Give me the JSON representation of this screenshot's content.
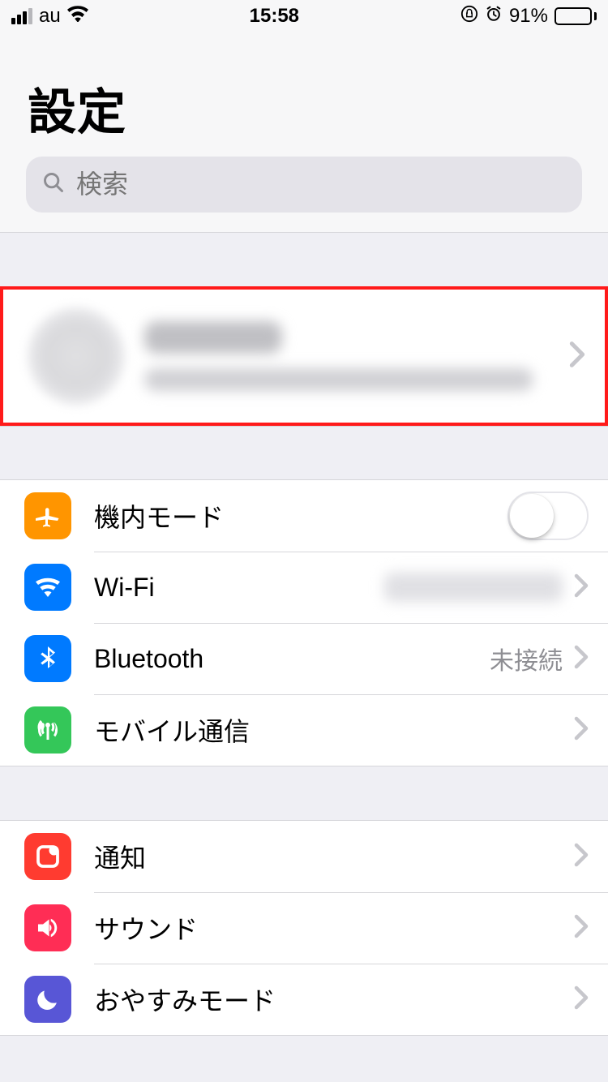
{
  "status": {
    "carrier": "au",
    "time": "15:58",
    "battery_pct": "91%"
  },
  "header": {
    "title": "設定"
  },
  "search": {
    "placeholder": "検索"
  },
  "profile": {
    "name": "",
    "subtitle": ""
  },
  "rows": {
    "airplane": {
      "label": "機内モード",
      "icon": "airplane-icon",
      "toggle": false
    },
    "wifi": {
      "label": "Wi-Fi",
      "icon": "wifi-icon",
      "value": ""
    },
    "bluetooth": {
      "label": "Bluetooth",
      "icon": "bluetooth-icon",
      "value": "未接続"
    },
    "cellular": {
      "label": "モバイル通信",
      "icon": "antenna-icon"
    },
    "notif": {
      "label": "通知",
      "icon": "notification-icon"
    },
    "sound": {
      "label": "サウンド",
      "icon": "speaker-icon"
    },
    "dnd": {
      "label": "おやすみモード",
      "icon": "moon-icon"
    }
  }
}
